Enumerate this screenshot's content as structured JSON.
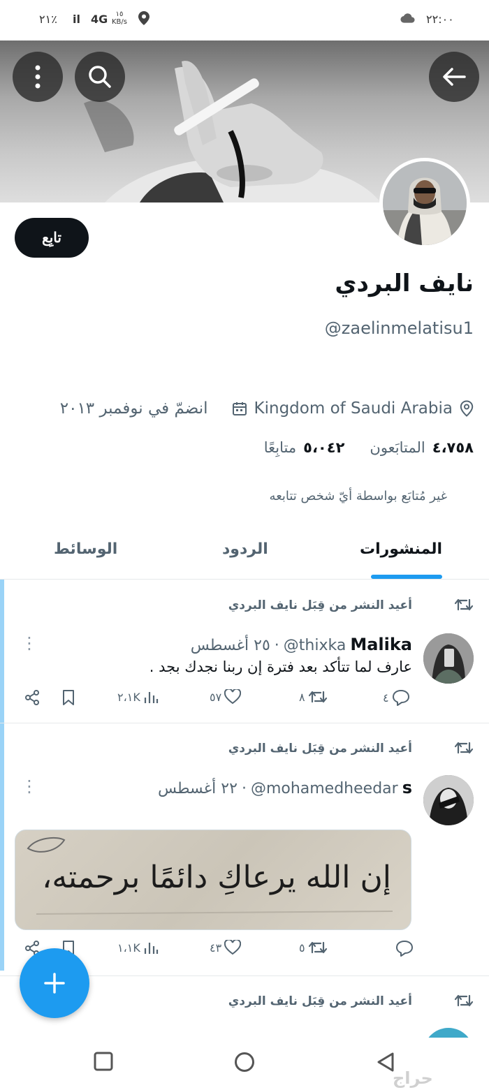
{
  "status_bar": {
    "battery": "٢١٪",
    "signal": "il",
    "network": "4G",
    "speed_value": "١٥",
    "speed_unit": "KB/s",
    "time": "٢٢:٠٠"
  },
  "profile": {
    "follow_label": "تابِع",
    "display_name": "نايف البردي",
    "username": "@zaelinmelatisu1",
    "location": "Kingdom of Saudi Arabia",
    "joined": "انضمّ في نوفمبر ٢٠١٣",
    "following_count": "٥،٠٤٢",
    "following_label": "متابِعًا",
    "followers_count": "٤،٧٥٨",
    "followers_label": "المتابَعون",
    "not_followed_note": "غير مُتابَع بواسطة أيّ شخص تتابعه"
  },
  "tabs": [
    {
      "label": "المنشورات",
      "active": true
    },
    {
      "label": "الردود",
      "active": false
    },
    {
      "label": "الوسائط",
      "active": false
    }
  ],
  "posts": [
    {
      "repost_label": "أعيد النشر من قِبَل نايف البردي",
      "author": "Malika",
      "handle": "@thixka",
      "date": "٢٥ أغسطس",
      "text": "عارف لما تتأكد بعد فترة إن ربنا نجدك بجد .",
      "replies": "٤",
      "reposts": "٨",
      "likes": "٥٧",
      "views": "٢،١K"
    },
    {
      "repost_label": "أعيد النشر من قِبَل نايف البردي",
      "author": "s",
      "handle": "@mohamedheedar",
      "date": "٢٢ أغسطس",
      "image_text": "إن الله يرعاكِ دائمًا برحمته،",
      "replies": "",
      "reposts": "٥",
      "likes": "٤٣",
      "views": "١،١K"
    },
    {
      "repost_label": "أعيد النشر من قِبَل نايف البردي"
    }
  ],
  "colors": {
    "accent": "#1d9bf0",
    "text_primary": "#0f1419",
    "text_secondary": "#536471"
  },
  "watermark": "حراج"
}
